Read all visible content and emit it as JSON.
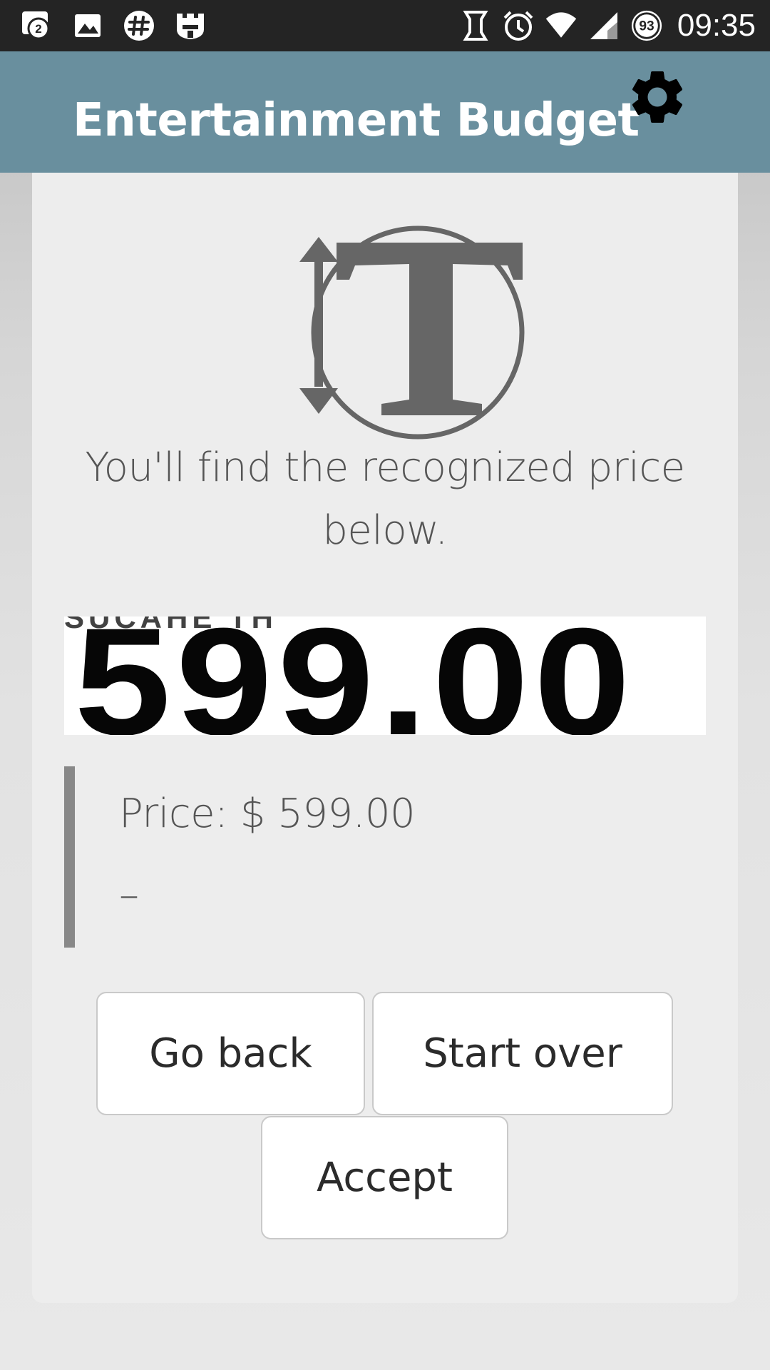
{
  "status_bar": {
    "notification_count": "2",
    "battery_level": "93",
    "time": "09:35",
    "left_icons": [
      "chat-notification-icon",
      "image-icon",
      "hash-app-icon",
      "castle-app-icon"
    ],
    "right_icons": [
      "nfc-icon",
      "alarm-icon",
      "wifi-icon",
      "signal-icon",
      "battery-icon"
    ]
  },
  "app_bar": {
    "title": "Entertainment Budget",
    "settings_icon": "gear-icon",
    "background": "#698f9e"
  },
  "main": {
    "message": "You'll find the recognized price below.",
    "recognized_image_text": "599.00",
    "recognized_image_fragment": "SUCAHE TH",
    "price_line": "Price: $ 599.00",
    "secondary_line": "–"
  },
  "buttons": {
    "go_back": "Go back",
    "start_over": "Start over",
    "accept": "Accept"
  }
}
